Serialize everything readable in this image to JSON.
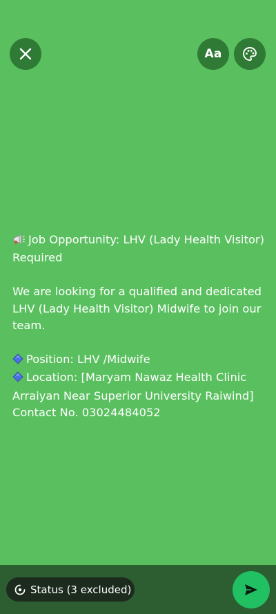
{
  "toolbar": {
    "close_icon": "close-icon",
    "font_label": "Aa",
    "palette_icon": "palette-icon"
  },
  "message": {
    "lines": [
      "Job Opportunity: LHV (Lady Health Visitor)",
      "Required",
      "",
      "We are looking for a qualified and dedicated",
      "LHV (Lady Health Visitor) Midwife to join our",
      "team.",
      "",
      "Position: LHV /Midwife",
      "Location: [Maryam Nawaz Health Clinic",
      "Arraiyan Near Superior University Raiwind]",
      "Contact No. 03024484052"
    ]
  },
  "footer": {
    "status_label": "Status (3 excluded)",
    "send_icon": "send-icon"
  },
  "colors": {
    "background": "#5ac05f",
    "button": "#2f7a34",
    "bottom_bar": "#2c5e31",
    "pill": "#1d2b1f",
    "send": "#21c063"
  }
}
